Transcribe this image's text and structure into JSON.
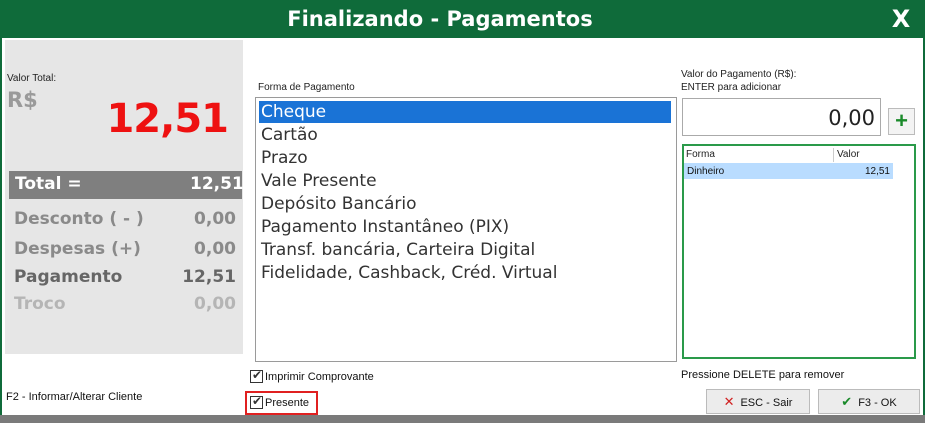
{
  "window": {
    "title": "Finalizando - Pagamentos",
    "close_glyph": "X",
    "accent_color": "#0f6b3a"
  },
  "summary": {
    "valor_total_label": "Valor Total:",
    "currency": "R$",
    "big_value": "12,51",
    "rows": [
      {
        "label": "Total =",
        "value": "12,51"
      },
      {
        "label": "Desconto ( - )",
        "value": "0,00"
      },
      {
        "label": "Despesas (+)",
        "value": "0,00"
      },
      {
        "label": "Pagamento",
        "value": "12,51"
      },
      {
        "label": "Troco",
        "value": "0,00"
      }
    ]
  },
  "payment_form": {
    "label": "Forma de Pagamento",
    "options": [
      "Cheque",
      "Cartão",
      "Prazo",
      "Vale Presente",
      "Depósito Bancário",
      "Pagamento Instantâneo (PIX)",
      "Transf. bancária, Carteira Digital",
      "Fidelidade, Cashback, Créd. Virtual"
    ],
    "selected_index": 0
  },
  "options": {
    "imprimir_label": "Imprimir Comprovante",
    "imprimir_checked": true,
    "presente_label": "Presente",
    "presente_checked": true
  },
  "client_hint": "F2 - Informar/Alterar Cliente",
  "payment_value": {
    "label_line1": "Valor do Pagamento (R$):",
    "label_line2": "ENTER para adicionar",
    "value": "0,00",
    "add_glyph": "+"
  },
  "payments_table": {
    "headers": [
      "Forma",
      "Valor"
    ],
    "rows": [
      {
        "forma": "Dinheiro",
        "valor": "12,51"
      }
    ],
    "remove_hint": "Pressione DELETE para remover"
  },
  "buttons": {
    "esc_label": "ESC - Sair",
    "esc_icon": "close-icon",
    "ok_label": "F3 - OK",
    "ok_icon": "check-icon"
  }
}
